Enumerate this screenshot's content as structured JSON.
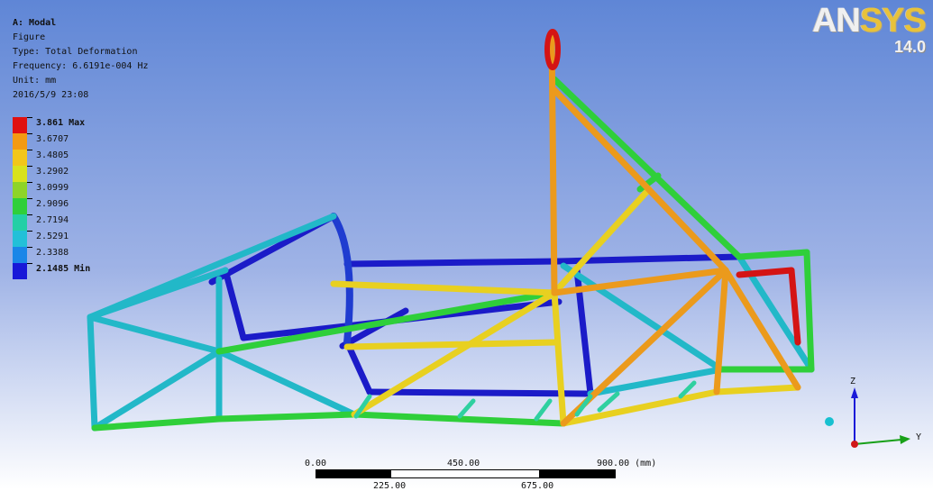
{
  "info": {
    "title": "A: Modal",
    "name": "Figure",
    "type": "Type: Total Deformation",
    "frequency": "Frequency: 6.6191e-004 Hz",
    "unit": "Unit: mm",
    "timestamp": "2016/5/9 23:08"
  },
  "legend": [
    {
      "value": "3.861",
      "tag": "Max",
      "color": "#e01010"
    },
    {
      "value": "3.6707",
      "tag": "",
      "color": "#f39a12"
    },
    {
      "value": "3.4805",
      "tag": "",
      "color": "#f2c61a"
    },
    {
      "value": "3.2902",
      "tag": "",
      "color": "#d8e21e"
    },
    {
      "value": "3.0999",
      "tag": "",
      "color": "#8ed428"
    },
    {
      "value": "2.9096",
      "tag": "",
      "color": "#2fcf3a"
    },
    {
      "value": "2.7194",
      "tag": "",
      "color": "#23cfa6"
    },
    {
      "value": "2.5291",
      "tag": "",
      "color": "#22c0d8"
    },
    {
      "value": "2.3388",
      "tag": "",
      "color": "#1a86e8"
    },
    {
      "value": "2.1485",
      "tag": "Min",
      "color": "#1818d8"
    }
  ],
  "logo": {
    "brand": "ANSYS",
    "version": "14.0"
  },
  "scale": {
    "top_labels": [
      "0.00",
      "450.00",
      "900.00 (mm)"
    ],
    "bottom_labels": [
      "225.00",
      "675.00"
    ]
  },
  "triad": {
    "z_label": "Z",
    "y_label": "Y"
  }
}
